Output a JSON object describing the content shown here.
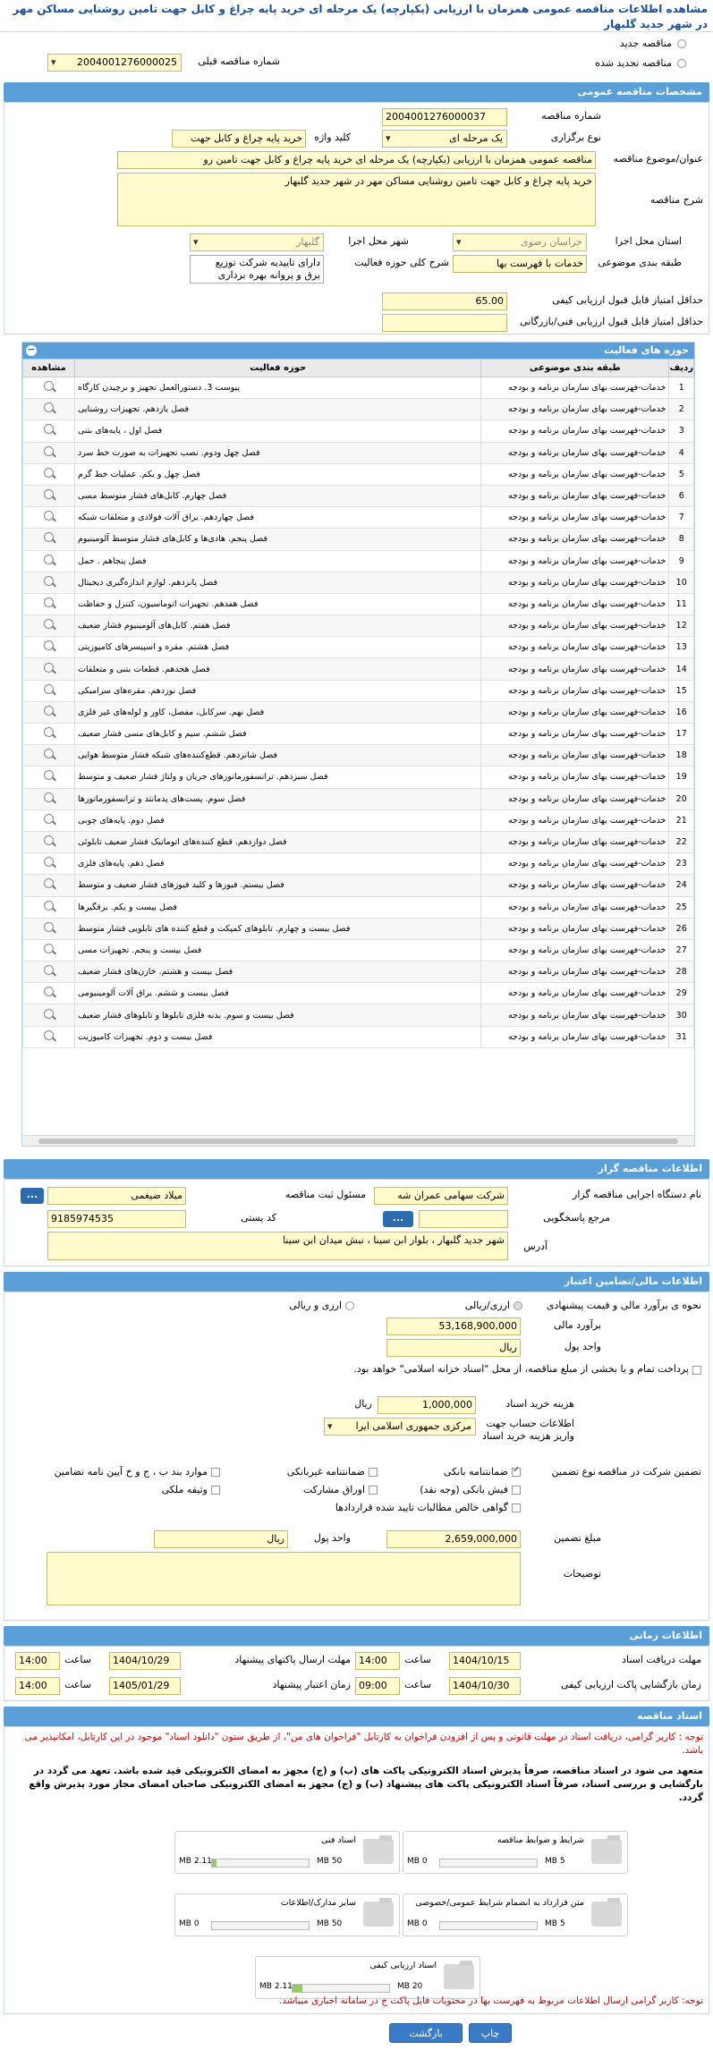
{
  "header": {
    "title": "مشاهده اطلاعات مناقصه عمومی همزمان با ارزیابی (یکپارچه) یک مرحله ای خرید پایه چراغ و کابل جهت تامین روشنایی مساکن مهر در شهر جدید گلبهار"
  },
  "top": {
    "new_tender": "مناقصه جدید",
    "renewed_tender": "مناقصه تجدید شده",
    "prev_number_label": "شماره مناقصه قبلی",
    "prev_number": "2004001276000025"
  },
  "general": {
    "section": "مشخصات مناقصه عمومی",
    "number_label": "شماره مناقصه",
    "number": "2004001276000037",
    "type_label": "نوع برگزاری",
    "type": "یک مرحله ای",
    "keyword_label": "کلید واژه",
    "keyword": "خرید پایه چراغ و کابل جهت",
    "subject_label": "عنوان/موضوع مناقصه",
    "subject": "مناقصه عمومی همزمان با ارزیابی (یکپارچه) یک مرحله ای خرید پایه چراغ و کابل جهت تامین رو",
    "desc_label": "شرح مناقصه",
    "desc": "خرید پایه چراغ و کابل جهت تامین روشنایی مساکن مهر در شهر جدید گلبهار",
    "province_label": "استان محل اجرا",
    "province": "خراسان رضوی",
    "city_label": "شهر محل اجرا",
    "city": "گلبهار",
    "class_label": "طبقه بندی موضوعی",
    "class": "خدمات با فهرست بها",
    "scope_label": "شرح کلی حوزه فعالیت",
    "scope_line1": "دارای تاییدیه شرکت توزیع",
    "scope_line2": "برق و پروانه بهره برداری",
    "min_quality_label": "حداقل امتیاز قابل قبول ارزیابی کیفی",
    "min_quality": "65.00",
    "min_tech_label": "حداقل امتیاز قابل قبول ارزیابی فنی/بازرگانی",
    "min_tech": ""
  },
  "activities": {
    "section": "حوزه های فعالیت",
    "col_row": "ردیف",
    "col_class": "طبقه بندی موضوعی",
    "col_area": "حوزه فعالیت",
    "col_view": "مشاهده",
    "rows": [
      {
        "n": "1",
        "c": "خدمات-فهرست بهای سازمان برنامه و بودجه",
        "a": "پیوست 3. دستورالعمل تجهیز و برچیدن کارگاه"
      },
      {
        "n": "2",
        "c": "خدمات-فهرست بهای سازمان برنامه و بودجه",
        "a": "فصل یازدهم. تجهیزات روشنایی"
      },
      {
        "n": "3",
        "c": "خدمات-فهرست بهای سازمان برنامه و بودجه",
        "a": "فصل اول ، پایه‌های بتنی"
      },
      {
        "n": "4",
        "c": "خدمات-فهرست بهای سازمان برنامه و بودجه",
        "a": "فصل چهل ودوم. نصب تجهیزات به صورت خط سرد"
      },
      {
        "n": "5",
        "c": "خدمات-فهرست بهای سازمان برنامه و بودجه",
        "a": "فصل چهل و یکم. عملیات خط گرم"
      },
      {
        "n": "6",
        "c": "خدمات-فهرست بهای سازمان برنامه و بودجه",
        "a": "فصل چهارم. کابل‌های فشار متوسط مسی"
      },
      {
        "n": "7",
        "c": "خدمات-فهرست بهای سازمان برنامه و بودجه",
        "a": "فصل چهاردهم. یراق آلات فولادی و متعلقات شبکه"
      },
      {
        "n": "8",
        "c": "خدمات-فهرست بهای سازمان برنامه و بودجه",
        "a": "فصل پنجم. هادی‌ها و کابل‌های فشار متوسط آلومینیوم"
      },
      {
        "n": "9",
        "c": "خدمات-فهرست بهای سازمان برنامه و بودجه",
        "a": "فصل پنجاهم . حمل"
      },
      {
        "n": "10",
        "c": "خدمات-فهرست بهای سازمان برنامه و بودجه",
        "a": "فصل پانزدهم. لوازم اندازه‌گیری دیجیتال"
      },
      {
        "n": "11",
        "c": "خدمات-فهرست بهای سازمان برنامه و بودجه",
        "a": "فصل هفدهم. تجهیزات اتوماسیون، کنترل و حفاظت"
      },
      {
        "n": "12",
        "c": "خدمات-فهرست بهای سازمان برنامه و بودجه",
        "a": "فصل هفتم. کابل‌های آلومینیوم فشار ضعیف"
      },
      {
        "n": "13",
        "c": "خدمات-فهرست بهای سازمان برنامه و بودجه",
        "a": "فصل هشتم. مقره و اسپیسرهای کامپوزیتی"
      },
      {
        "n": "14",
        "c": "خدمات-فهرست بهای سازمان برنامه و بودجه",
        "a": "فصل هجدهم. قطعات بتنی و متعلقات"
      },
      {
        "n": "15",
        "c": "خدمات-فهرست بهای سازمان برنامه و بودجه",
        "a": "فصل نوزدهم. مقره‌های سرامیکی"
      },
      {
        "n": "16",
        "c": "خدمات-فهرست بهای سازمان برنامه و بودجه",
        "a": "فصل نهم. سرکابل، مفصل، کاور و لوله‌های غیر فلزی"
      },
      {
        "n": "17",
        "c": "خدمات-فهرست بهای سازمان برنامه و بودجه",
        "a": "فصل ششم. سیم و کابل‌های مسی فشار ضعیف"
      },
      {
        "n": "18",
        "c": "خدمات-فهرست بهای سازمان برنامه و بودجه",
        "a": "فصل شانزدهم. قطع‌کننده‌های شبکه فشار متوسط هوایی"
      },
      {
        "n": "19",
        "c": "خدمات-فهرست بهای سازمان برنامه و بودجه",
        "a": "فصل سیزدهم. ترانسفورماتورهای جریان و ولتاژ فشار ضعیف و متوسط"
      },
      {
        "n": "20",
        "c": "خدمات-فهرست بهای سازمان برنامه و بودجه",
        "a": "فصل سوم. پست‌های پدمانتد و ترانسفورماتورها"
      },
      {
        "n": "21",
        "c": "خدمات-فهرست بهای سازمان برنامه و بودجه",
        "a": "فصل دوم. پایه‌های چوبی"
      },
      {
        "n": "22",
        "c": "خدمات-فهرست بهای سازمان برنامه و بودجه",
        "a": "فصل دوازدهم. قطع کننده‌های اتوماتیک فشار ضعیف تابلوئی"
      },
      {
        "n": "23",
        "c": "خدمات-فهرست بهای سازمان برنامه و بودجه",
        "a": "فصل دهم. پایه‌های فلزی"
      },
      {
        "n": "24",
        "c": "خدمات-فهرست بهای سازمان برنامه و بودجه",
        "a": "فصل بیستم. فیوزها و کلید فیوزهای فشار ضعیف و متوسط"
      },
      {
        "n": "25",
        "c": "خدمات-فهرست بهای سازمان برنامه و بودجه",
        "a": "فصل بیست و یکم. برقگیرها"
      },
      {
        "n": "26",
        "c": "خدمات-فهرست بهای سازمان برنامه و بودجه",
        "a": "فصل بیست و چهارم. تابلوهای کمپکت و قطع کننده های تابلویی فشار متوسط"
      },
      {
        "n": "27",
        "c": "خدمات-فهرست بهای سازمان برنامه و بودجه",
        "a": "فصل بیست و پنجم. تجهیزات مسی"
      },
      {
        "n": "28",
        "c": "خدمات-فهرست بهای سازمان برنامه و بودجه",
        "a": "فصل بیست و هشتم. خازن‌های فشار ضعیف"
      },
      {
        "n": "29",
        "c": "خدمات-فهرست بهای سازمان برنامه و بودجه",
        "a": "فصل بیست و ششم. یراق آلات آلومینیومی"
      },
      {
        "n": "30",
        "c": "خدمات-فهرست بهای سازمان برنامه و بودجه",
        "a": "فصل بیست و سوم. بدنه فلزی تابلوها و تابلوهای فشار ضعیف"
      },
      {
        "n": "31",
        "c": "خدمات-فهرست بهای سازمان برنامه و بودجه",
        "a": "فصل بیست و دوم. تجهیزات کامپوزیت"
      }
    ]
  },
  "organizer": {
    "section": "اطلاعات مناقصه گزار",
    "org_label": "نام دستگاه اجرایی مناقصه گزار",
    "org": "شرکت سهامی عمران شه",
    "resp_label": "مسئول ثبت مناقصه",
    "resp": "میلاد ضیغمی",
    "ref_label": "مرجع پاسخگویی",
    "ref": "",
    "postal_label": "کد پستی",
    "postal": "9185974535",
    "addr_label": "آدرس",
    "addr": "شهر جدید گلبهار ، بلوار ابن سینا ، نبش میدان ابن سینا",
    "dots": "..."
  },
  "finance": {
    "section": "اطلاعات مالی/تضامین اعتبار",
    "estimate_type_label": "نحوه ی برآورد مالی و قیمت پیشنهادی",
    "opt_rial": "ارزی/ریالی",
    "opt_fx": "ارزی و ریالی",
    "estimate_label": "برآورد مالی",
    "estimate": "53,168,900,000",
    "unit_label": "واحد پول",
    "unit": "ریال",
    "treasury_note": "پرداخت تمام و یا بخشی از مبلغ مناقصه، از محل \"اسناد خزانه اسلامی\" خواهد بود.",
    "doc_fee_label": "هزینه خرید اسناد",
    "doc_fee": "1,000,000",
    "doc_fee_unit": "ریال",
    "account_label": "اطلاعات حساب جهت واریز هزینه خرید اسناد",
    "account": "مرکزی جمهوری اسلامی ایرا",
    "guar_label": "نوع تضمین",
    "guar_participation_label": "تضمین شرکت در مناقصه",
    "g1": "ضمانتنامه بانکی",
    "g2": "ضمانتنامه غیربانکی",
    "g3": "موارد بند ب ، ج و خ آیین نامه تضامین",
    "g4": "فیش بانکی (وجه نقد)",
    "g5": "اوراق مشارکت",
    "g6": "وثیقه ملکی",
    "g7": "گواهی خالص مطالبات تایید شده قراردادها",
    "amount_label": "مبلغ تضمین",
    "amount": "2,659,000,000",
    "amount_unit_label": "واحد پول",
    "amount_unit": "ریال",
    "notes_label": "توضیحات"
  },
  "timing": {
    "section": "اطلاعات زمانی",
    "recv_label": "مهلت دریافت اسناد",
    "recv_date": "1404/10/15",
    "recv_time": "14:00",
    "send_label": "مهلت ارسال پاکتهای پیشنهاد",
    "send_date": "1404/10/29",
    "send_time": "14:00",
    "open_label": "زمان بازگشایی پاکت ارزیابی کیفی",
    "open_date": "1404/10/30",
    "open_time": "09:00",
    "valid_label": "زمان اعتبار پیشنهاد",
    "valid_date": "1405/01/29",
    "valid_time": "14:00",
    "time_label": "ساعت"
  },
  "docs": {
    "section": "اسناد مناقصه",
    "note1": "توجه : کاربر گرامی، دریافت اسناد در مهلت قانونی و پس از افزودن فراخوان به کارتابل \"فراخوان های من\"، از طریق ستون \"دانلود اسناد\" موجود در این کارتابل، امکانپذیر می باشد.",
    "note2": "متعهد می شود در اسناد مناقصه، صرفاً پذیرش اسناد الکترونیکی پاکت های (ب) و (ج) مجهز به امضای الکترونیکی قید شده باشد. تعهد می گردد در بارگشایی و بررسی اسناد، صرفاً اسناد الکترونیکی پاکت های پیشنهاد (ب) و (ج) مجهز به امضای الکترونیکی صاحبان امضای مجاز مورد پذیرش واقع گردد.",
    "items": [
      {
        "name": "شرایط و ضوابط مناقصه",
        "size": "0 MB",
        "max": "5 MB",
        "fill": 0
      },
      {
        "name": "اسناد فنی",
        "size": "2.11 MB",
        "max": "50 MB",
        "fill": 0.05
      },
      {
        "name": "متن قرارداد به انضمام شرایط عمومی/خصوصی",
        "size": "0 MB",
        "max": "5 MB",
        "fill": 0
      },
      {
        "name": "سایر مدارک/اطلاعات",
        "size": "0 MB",
        "max": "50 MB",
        "fill": 0
      },
      {
        "name": "اسناد ارزیابی کیفی",
        "size": "2.11 MB",
        "max": "20 MB",
        "fill": 0.1
      }
    ],
    "note3": "توجه: کاربر گرامی ارسال اطلاعات مربوط به فهرست بها در محتویات فایل پاکت ج در سامانه اجباری میباشد."
  },
  "footer": {
    "print": "چاپ",
    "back": "بازگشت"
  },
  "colors": {
    "section": "#5a9fd8",
    "field": "#fffbcc"
  }
}
